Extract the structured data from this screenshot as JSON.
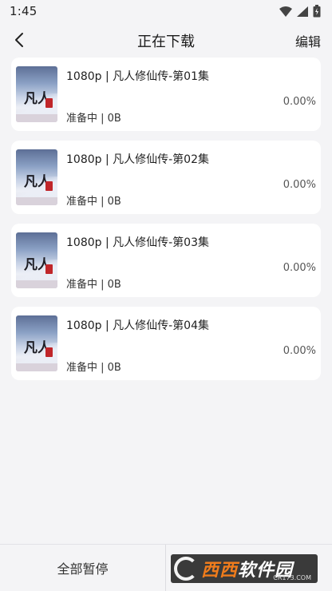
{
  "status_bar": {
    "time": "1:45",
    "icons": [
      "wifi-icon",
      "signal-icon",
      "battery-icon"
    ]
  },
  "nav": {
    "back_icon": "chevron-left-icon",
    "title": "正在下载",
    "edit_label": "编辑"
  },
  "downloads": [
    {
      "title": "1080p | 凡人修仙传-第01集",
      "progress": "0.00%",
      "status": "准备中 | 0B"
    },
    {
      "title": "1080p | 凡人修仙传-第02集",
      "progress": "0.00%",
      "status": "准备中 | 0B"
    },
    {
      "title": "1080p | 凡人修仙传-第03集",
      "progress": "0.00%",
      "status": "准备中 | 0B"
    },
    {
      "title": "1080p | 凡人修仙传-第04集",
      "progress": "0.00%",
      "status": "准备中 | 0B"
    }
  ],
  "poster": {
    "art_text": "凡人"
  },
  "bottom": {
    "pause_all_label": "全部暂停"
  },
  "watermark": {
    "brand_accent": "西西",
    "brand_rest": "软件园",
    "url": "CR173.COM"
  },
  "colors": {
    "background": "#f4f4f6",
    "card": "#ffffff",
    "text": "#222222",
    "watermark_accent": "#f07c1c"
  }
}
